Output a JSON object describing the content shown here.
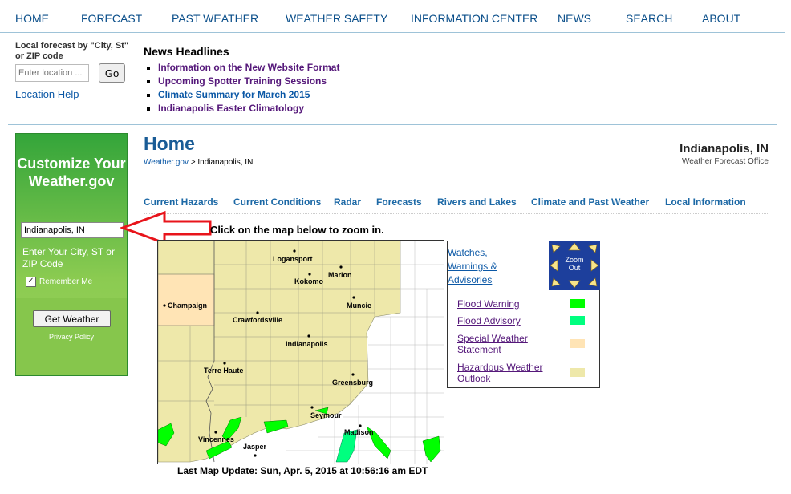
{
  "nav": [
    "HOME",
    "FORECAST",
    "PAST WEATHER",
    "WEATHER SAFETY",
    "INFORMATION CENTER",
    "NEWS",
    "SEARCH",
    "ABOUT"
  ],
  "local": {
    "label": "Local forecast by \"City, St\" or ZIP code",
    "placeholder": "Enter location ...",
    "go": "Go",
    "help": "Location Help"
  },
  "news": {
    "heading": "News Headlines",
    "items": [
      "Information on the New Website Format",
      "Upcoming Spotter Training Sessions",
      "Climate Summary for March 2015",
      "Indianapolis Easter Climatology"
    ]
  },
  "customize": {
    "title": "Customize Your Weather.gov",
    "value": "Indianapolis, IN",
    "hint": "Enter Your City, ST or ZIP Code",
    "remember": "Remember Me",
    "button": "Get Weather",
    "privacy": "Privacy Policy"
  },
  "page": {
    "title": "Home",
    "crumb_link": "Weather.gov",
    "crumb_rest": "> Indianapolis, IN",
    "office": "Indianapolis, IN",
    "office_sub": "Weather Forecast Office"
  },
  "subnav": [
    "Current Hazards",
    "Current Conditions",
    "Radar",
    "Forecasts",
    "Rivers and Lakes",
    "Climate and Past Weather",
    "Local Information"
  ],
  "map": {
    "instruction": "Click on the map below to zoom in.",
    "cities": [
      "Logansport",
      "Marion",
      "Kokomo",
      "Muncie",
      "Champaign",
      "Crawfordsville",
      "Indianapolis",
      "Terre Haute",
      "Greensburg",
      "Seymour",
      "Madison",
      "Vincennes",
      "Jasper"
    ],
    "updated": "Last Map Update: Sun, Apr. 5, 2015 at 10:56:16 am EDT"
  },
  "legend": {
    "watches": "Watches, Warnings & Advisories",
    "zoom": "Zoom Out",
    "items": [
      {
        "label": "Flood Warning",
        "color": "#00ff00"
      },
      {
        "label": "Flood Advisory",
        "color": "#00ff7f"
      },
      {
        "label": "Special Weather Statement",
        "color": "#ffe4b5"
      },
      {
        "label": "Hazardous Weather Outlook",
        "color": "#eee8aa"
      }
    ]
  }
}
